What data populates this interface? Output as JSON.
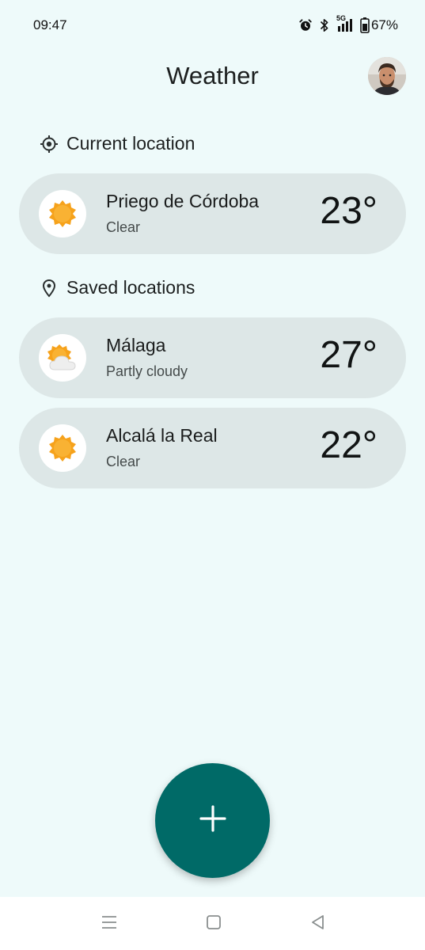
{
  "status_bar": {
    "time": "09:47",
    "network": "5G",
    "battery": "67%",
    "icons": [
      "alarm-icon",
      "bluetooth-icon",
      "signal-icon",
      "battery-icon"
    ]
  },
  "app_bar": {
    "title": "Weather"
  },
  "current_section": {
    "label": "Current location",
    "icon": "my-location-icon"
  },
  "current_location": {
    "name": "Priego de Córdoba",
    "condition": "Clear",
    "temp": "23°",
    "icon": "sun-icon"
  },
  "saved_section": {
    "label": "Saved locations",
    "icon": "location-pin-icon"
  },
  "saved_locations": [
    {
      "name": "Málaga",
      "condition": "Partly cloudy",
      "temp": "27°",
      "icon": "partly-cloudy-icon"
    },
    {
      "name": "Alcalá la Real",
      "condition": "Clear",
      "temp": "22°",
      "icon": "sun-icon"
    }
  ],
  "colors": {
    "background": "#eefafa",
    "card": "#dde7e7",
    "fab": "#006a67",
    "sun": "#f6a21b"
  }
}
